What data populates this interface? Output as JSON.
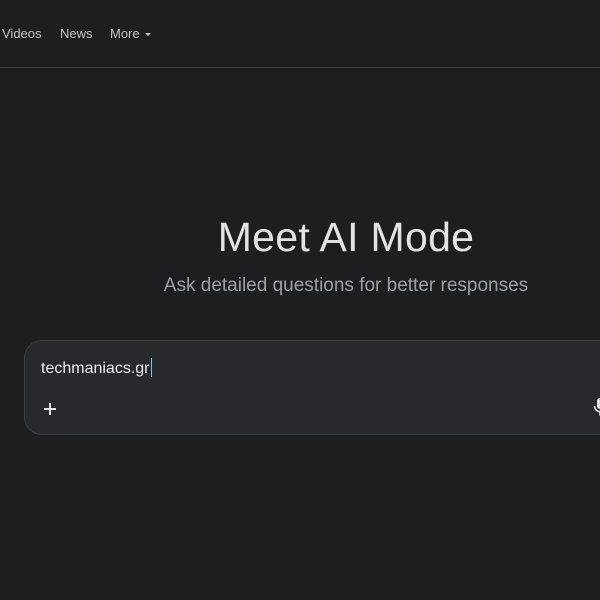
{
  "nav": {
    "tabs": [
      {
        "label": "Videos"
      },
      {
        "label": "News"
      },
      {
        "label": "More"
      }
    ]
  },
  "hero": {
    "title": "Meet AI Mode",
    "subtitle": "Ask detailed questions for better responses"
  },
  "search": {
    "value": "techmaniacs.gr"
  },
  "icons": {
    "plus": "plus-icon",
    "mic": "microphone-icon",
    "more_caret": "chevron-down-icon"
  },
  "colors": {
    "background": "#1e1e20",
    "search_box": "#28292c",
    "cursor": "#8ab4f8"
  }
}
